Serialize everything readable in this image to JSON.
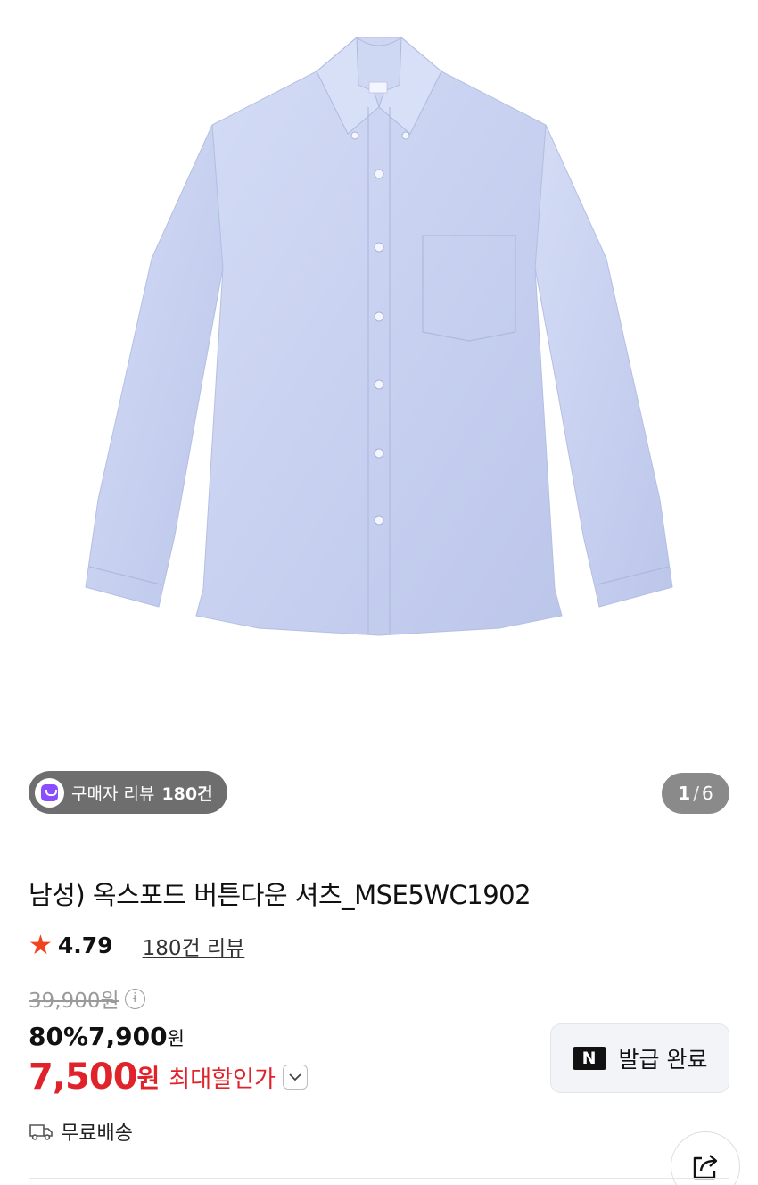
{
  "gallery": {
    "image_alt": "",
    "current_page": "1",
    "separator": "/",
    "total_pages": "6"
  },
  "review_badge": {
    "label": "구매자 리뷰",
    "count": "180건"
  },
  "product": {
    "title": "남성) 옥스포드 버튼다운 셔츠_MSE5WC1902"
  },
  "rating": {
    "value": "4.79",
    "reviews_link": "180건 리뷰"
  },
  "price": {
    "original": "39,900원",
    "discount_rate": "80%",
    "sale": "7,900",
    "sale_unit": "원",
    "max_discount_price": "7,500",
    "max_unit": "원",
    "max_label": "최대할인가"
  },
  "coupon": {
    "badge": "N",
    "label": "발급 완료"
  },
  "shipping": {
    "label": "무료배송"
  },
  "colors": {
    "accent_red": "#e0232b",
    "star": "#f2431f",
    "shirt": "#c9d3f0"
  },
  "icons": [
    "info-icon",
    "chevron-down-icon",
    "truck-icon",
    "share-icon",
    "star-icon",
    "shopping-bag-icon"
  ]
}
